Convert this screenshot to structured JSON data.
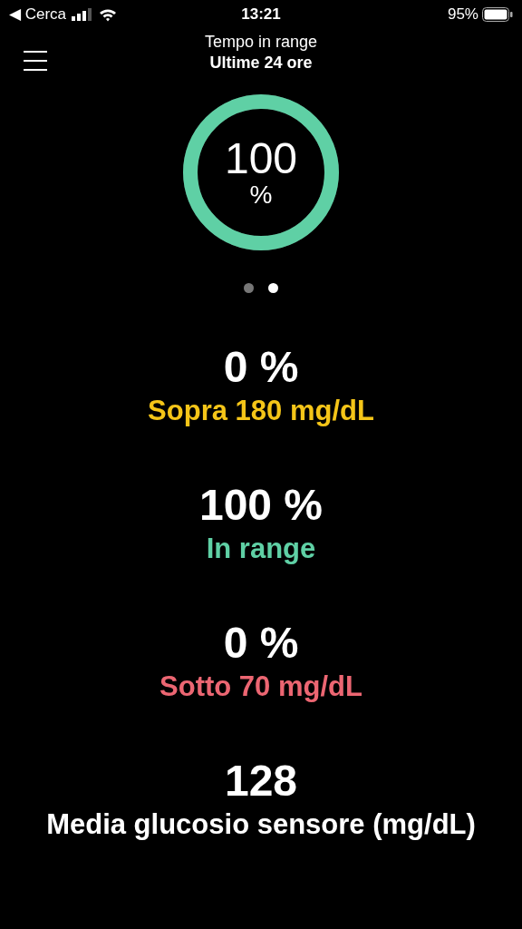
{
  "status_bar": {
    "back_label": "◀ Cerca",
    "time": "13:21",
    "battery": "95%"
  },
  "header": {
    "title": "Tempo in range",
    "subtitle": "Ultime 24 ore"
  },
  "ring": {
    "value": "100",
    "unit": "%",
    "level": 1,
    "color": "#5fd0a5"
  },
  "pager": [
    {
      "selected": false
    },
    {
      "selected": true
    }
  ],
  "stats": [
    {
      "value": "0 %",
      "label": "Sopra 180 mg/dL",
      "color": "#f5c518"
    },
    {
      "value": "100 %",
      "label": "In range",
      "color": "#5fd0a5"
    },
    {
      "value": "0 %",
      "label": "Sotto 70 mg/dL",
      "color": "#ec6672"
    },
    {
      "value": "128",
      "label": "Media glucosio sensore (mg/dL)",
      "color": "#ffffff"
    }
  ]
}
